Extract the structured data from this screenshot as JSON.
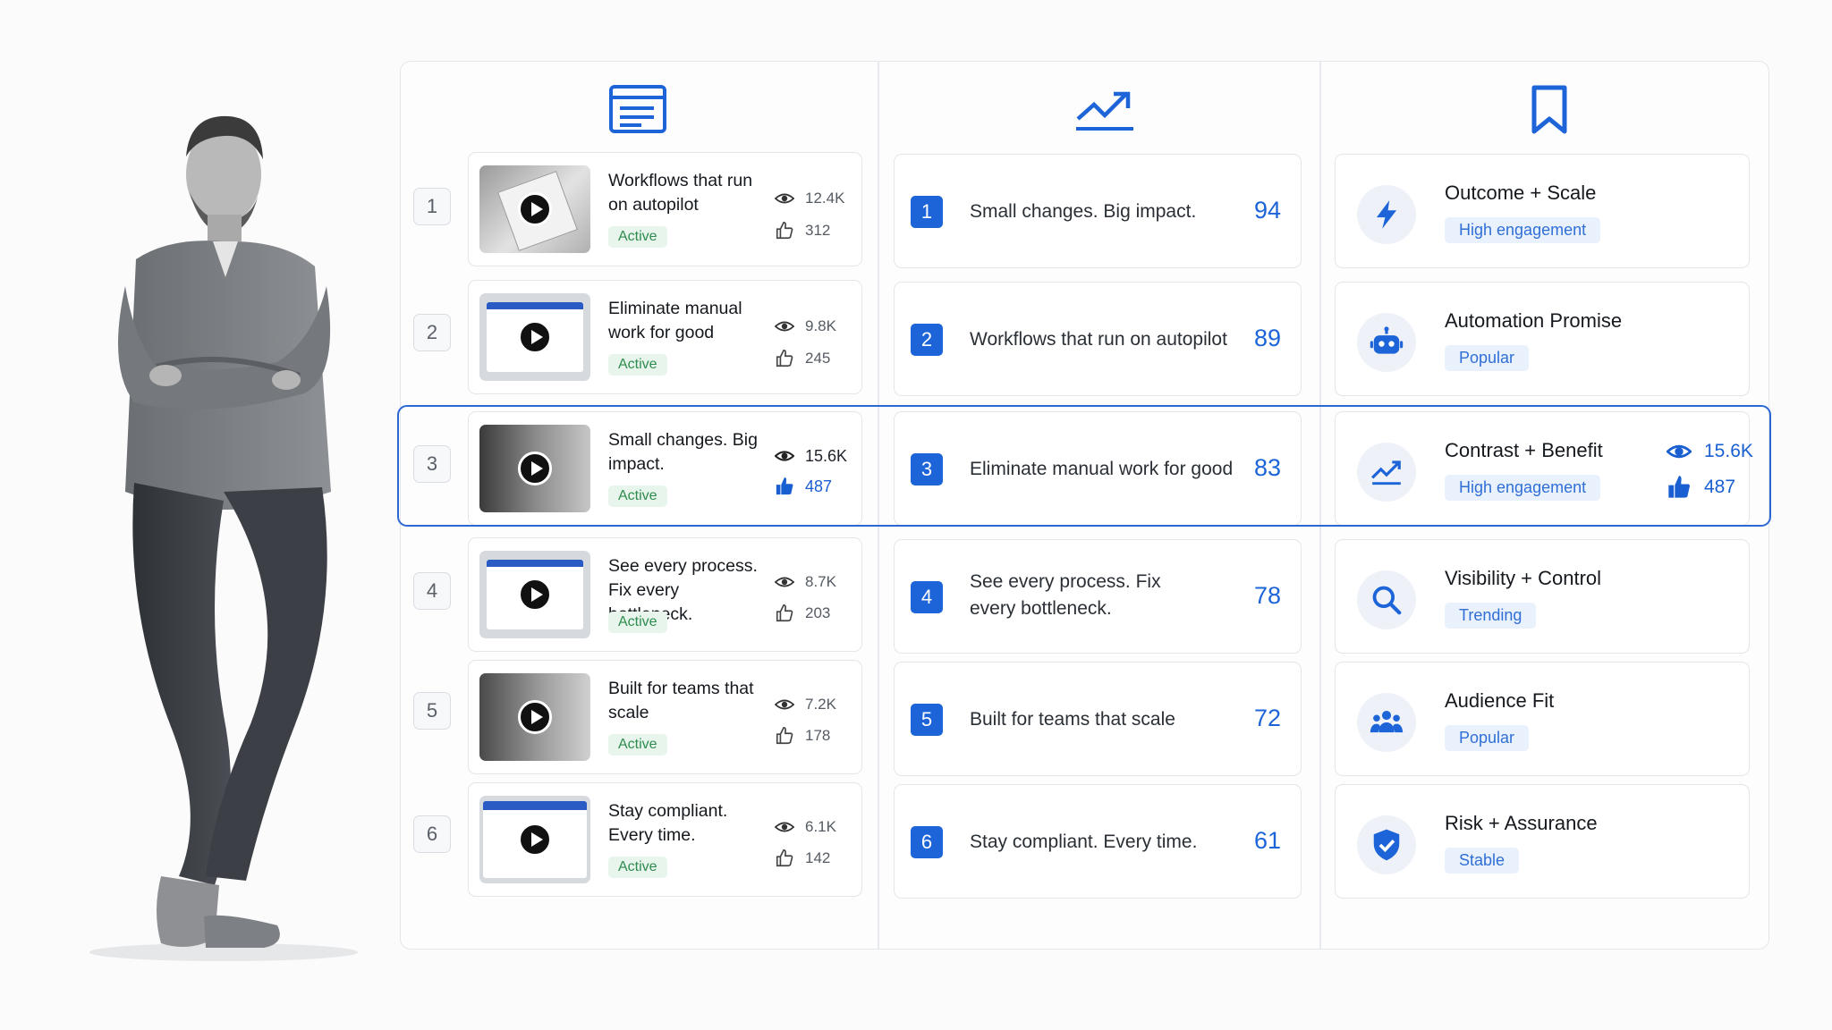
{
  "column_icons": {
    "col1": "article-icon",
    "col2": "trending-up-icon",
    "col3": "bookmark-icon"
  },
  "colors": {
    "accent": "#1c64d8",
    "status_green": "#2e8b4e",
    "highlight_border": "#2c67d2"
  },
  "selected_row_index": 3,
  "videos": [
    {
      "num": "1",
      "title": "Workflows that run on autopilot",
      "status": "Active",
      "views": "12.4K",
      "likes": "312"
    },
    {
      "num": "2",
      "title": "Eliminate manual work for good",
      "status": "Active",
      "views": "9.8K",
      "likes": "245"
    },
    {
      "num": "3",
      "title": "Small changes. Big impact.",
      "status": "Active",
      "views": "15.6K",
      "likes": "487"
    },
    {
      "num": "4",
      "title": "See every process. Fix every bottleneck.",
      "status": "Active",
      "views": "8.7K",
      "likes": "203"
    },
    {
      "num": "5",
      "title": "Built for teams that scale",
      "status": "Active",
      "views": "7.2K",
      "likes": "178"
    },
    {
      "num": "6",
      "title": "Stay compliant. Every time.",
      "status": "Active",
      "views": "6.1K",
      "likes": "142"
    }
  ],
  "ranking": [
    {
      "num": "1",
      "text": "Small changes. Big impact.",
      "score": "94"
    },
    {
      "num": "2",
      "text": "Workflows that run on autopilot",
      "score": "89"
    },
    {
      "num": "3",
      "text": "Eliminate manual work for good",
      "score": "83"
    },
    {
      "num": "4",
      "text": "See every process. Fix every bottleneck.",
      "score": "78"
    },
    {
      "num": "5",
      "text": "Built for teams that scale",
      "score": "72"
    },
    {
      "num": "6",
      "text": "Stay compliant. Every time.",
      "score": "61"
    }
  ],
  "themes": [
    {
      "title": "Outcome + Scale",
      "badge": "High engagement",
      "icon": "lightning-icon"
    },
    {
      "title": "Automation Promise",
      "badge": "Popular",
      "icon": "robot-icon"
    },
    {
      "title": "Contrast + Benefit",
      "badge": "High engagement",
      "icon": "trending-up-icon",
      "views": "15.6K",
      "likes": "487"
    },
    {
      "title": "Visibility + Control",
      "badge": "Trending",
      "icon": "search-icon"
    },
    {
      "title": "Audience Fit",
      "badge": "Popular",
      "icon": "people-icon"
    },
    {
      "title": "Risk + Assurance",
      "badge": "Stable",
      "icon": "shield-check-icon"
    }
  ]
}
